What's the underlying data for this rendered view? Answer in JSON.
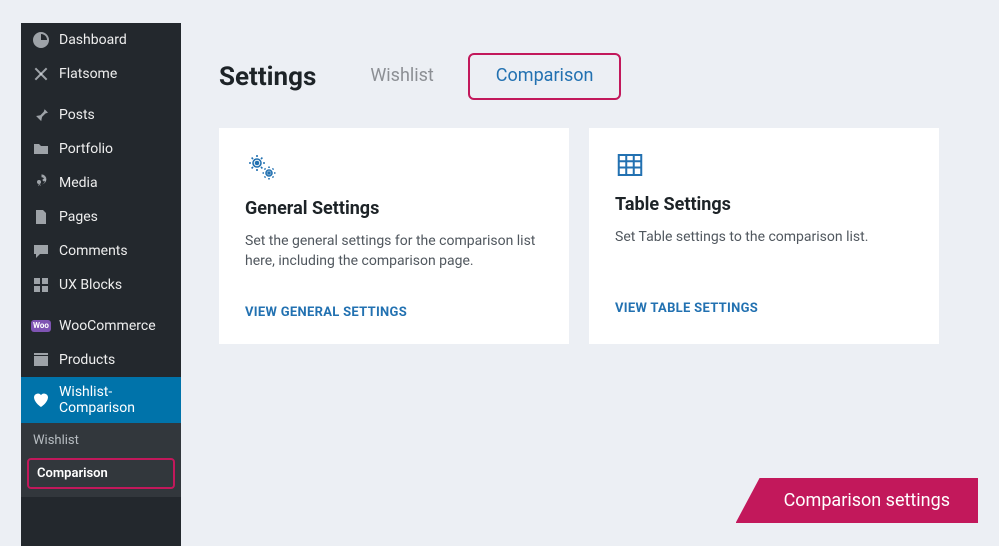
{
  "sidebar": {
    "items": [
      {
        "icon": "dashboard",
        "label": "Dashboard"
      },
      {
        "icon": "flatsome",
        "label": "Flatsome"
      },
      {
        "icon": "pin",
        "label": "Posts"
      },
      {
        "icon": "portfolio",
        "label": "Portfolio"
      },
      {
        "icon": "media",
        "label": "Media"
      },
      {
        "icon": "page",
        "label": "Pages"
      },
      {
        "icon": "comment",
        "label": "Comments"
      },
      {
        "icon": "blocks",
        "label": "UX Blocks"
      },
      {
        "icon": "woo",
        "label": "WooCommerce"
      },
      {
        "icon": "products",
        "label": "Products"
      },
      {
        "icon": "heart",
        "label": "Wishlist-Comparison"
      }
    ],
    "submenu": [
      {
        "label": "Wishlist"
      },
      {
        "label": "Comparison"
      }
    ]
  },
  "page": {
    "title": "Settings",
    "tabs": [
      {
        "label": "Wishlist"
      },
      {
        "label": "Comparison"
      }
    ]
  },
  "cards": [
    {
      "title": "General Settings",
      "desc": "Set the general settings for the comparison list here, including the comparison page.",
      "link": "VIEW GENERAL SETTINGS"
    },
    {
      "title": "Table Settings",
      "desc": "Set Table settings to the comparison list.",
      "link": "VIEW TABLE SETTINGS"
    }
  ],
  "banner": {
    "text": "Comparison settings"
  }
}
